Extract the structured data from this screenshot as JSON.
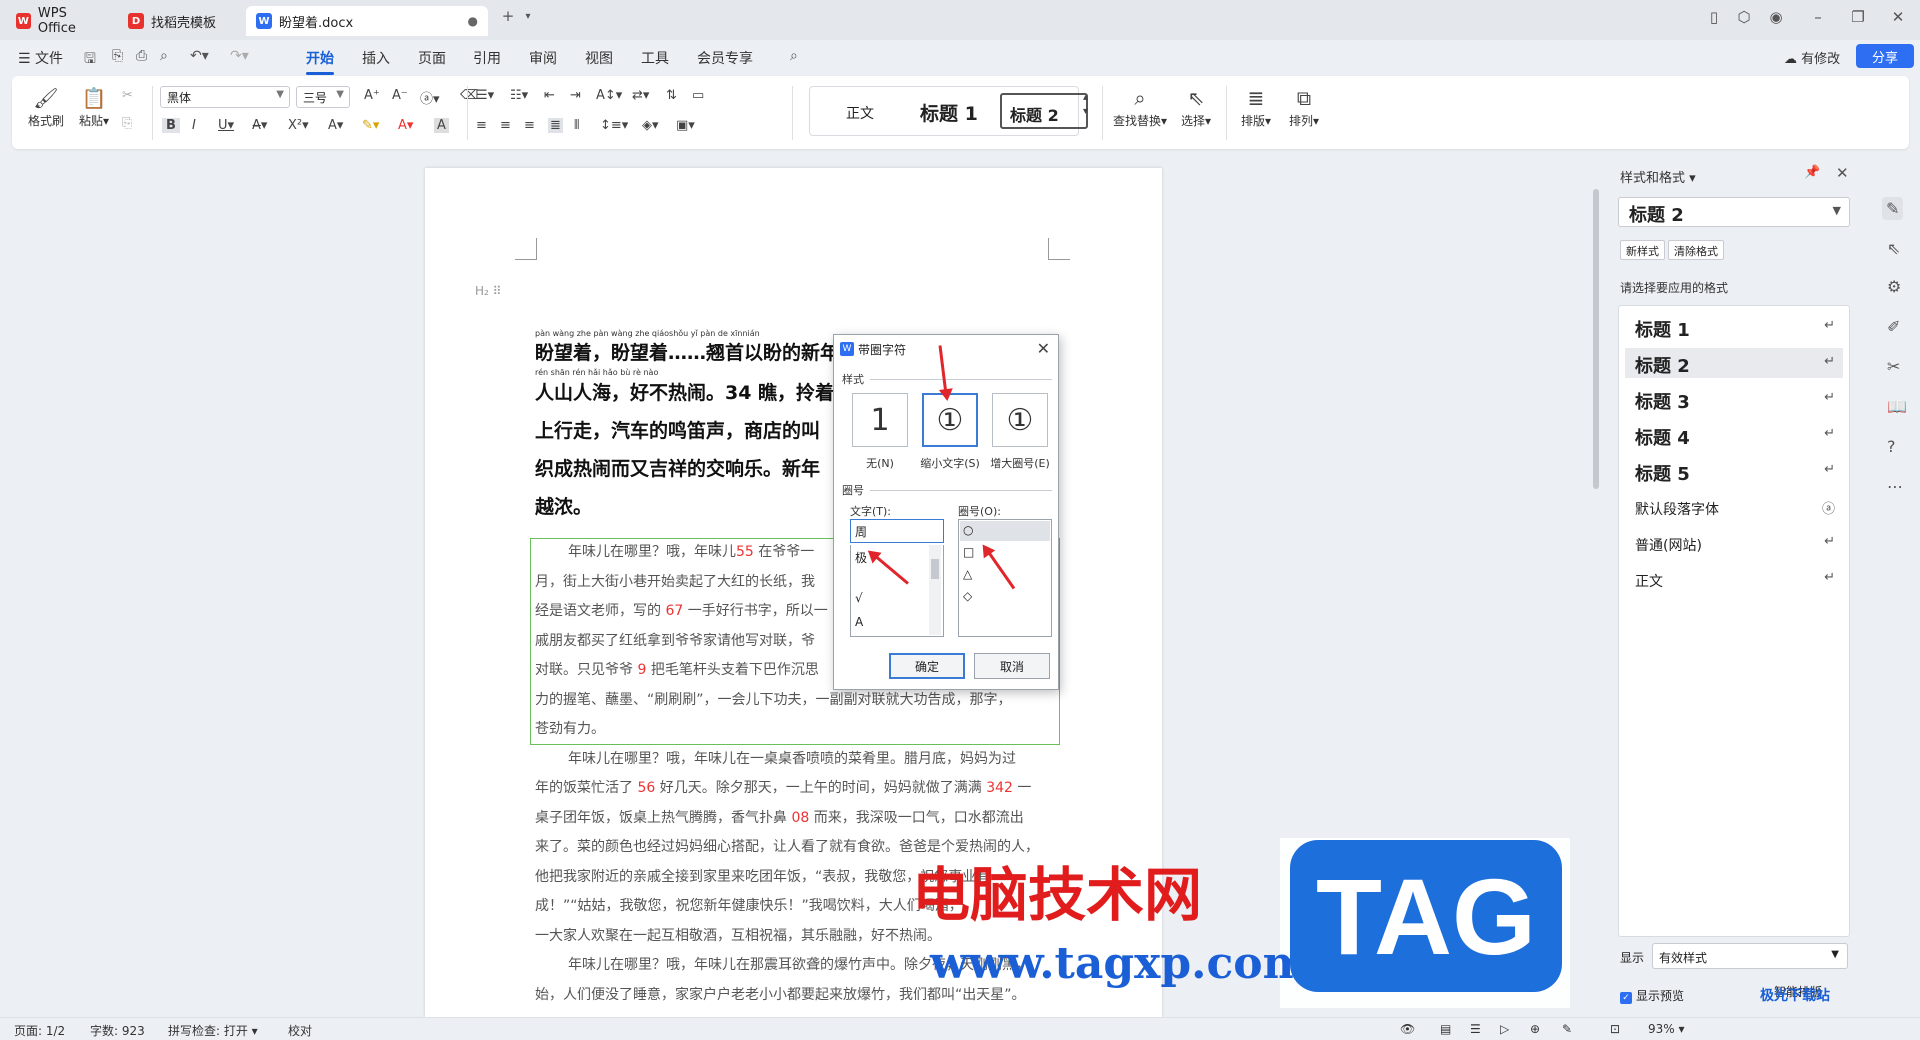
{
  "tabs": [
    {
      "label": "WPS Office",
      "icon": "wps-icon"
    },
    {
      "label": "找稻壳模板",
      "icon": "docer-icon"
    },
    {
      "label": "盼望着.docx",
      "icon": "word-doc-icon"
    }
  ],
  "menu": {
    "file": "文件",
    "items": [
      "开始",
      "插入",
      "页面",
      "引用",
      "审阅",
      "视图",
      "工具",
      "会员专享"
    ],
    "active": "开始",
    "modify": "有修改",
    "share": "分享"
  },
  "ribbon": {
    "format_painter": "格式刷",
    "paste": "粘贴",
    "font": "黑体",
    "font_size": "三号",
    "styles": [
      "正文",
      "标题 1",
      "标题 2"
    ],
    "find_replace": "查找替换",
    "select": "选择",
    "layout": "排版",
    "arrange": "排列"
  },
  "document": {
    "heading_lines": [
      "盼望着，盼望着……翘首以盼的新年",
      "人山人海，好不热闹。34 瞧，拎着",
      "上行走，汽车的鸣笛声，商店的叫",
      "织成热闹而又吉祥的交响乐。新年",
      "越浓。"
    ],
    "ruby_lines": [
      "pàn wàng zhe       pàn wàng zhe              qiáoshǒu yǐ pàn de  xīnnián",
      "rén shān rén hǎi          hǎo bù rè nào"
    ],
    "paragraphs": [
      [
        {
          "t": "年味儿在哪里？哦，年味儿"
        },
        {
          "t": "55",
          "red": true
        },
        {
          "t": " 在爷爷一"
        }
      ],
      [
        {
          "t": "月，街上大街小巷开始卖起了大红的长纸，我"
        }
      ],
      [
        {
          "t": "经是语文老师，写的 "
        },
        {
          "t": "67",
          "red": true
        },
        {
          "t": " 一手好行书字，所以一"
        }
      ],
      [
        {
          "t": "戚朋友都买了红纸拿到爷爷家请他写对联，爷"
        }
      ],
      [
        {
          "t": "对联。只见爷爷 "
        },
        {
          "t": "9",
          "red": true
        },
        {
          "t": " 把毛笔杆头支着下巴作沉思"
        }
      ],
      [
        {
          "t": "力的握笔、蘸墨、“刷刷刷”，一会儿下功夫，一副副对联就大功告成，那字，"
        }
      ],
      [
        {
          "t": "苍劲有力。"
        }
      ],
      [
        {
          "t": "年味儿在哪里？哦，年味儿在一桌桌香喷喷的菜肴里。腊月底，妈妈为过"
        }
      ],
      [
        {
          "t": "年的饭菜忙活了 "
        },
        {
          "t": "56",
          "red": true
        },
        {
          "t": " 好几天。除夕那天，一上午的时间，妈妈就做了满满 "
        },
        {
          "t": "342",
          "red": true
        },
        {
          "t": " 一"
        }
      ],
      [
        {
          "t": "桌子团年饭，饭桌上热气腾腾，香气扑鼻 "
        },
        {
          "t": "08",
          "red": true
        },
        {
          "t": " 而来，我深吸一口气，口水都流出"
        }
      ],
      [
        {
          "t": "来了。菜的颜色也经过妈妈细心搭配，让人看了就有食欲。爸爸是个爱热闹的人，"
        }
      ],
      [
        {
          "t": "他把我家附近的亲戚全接到家里来吃团年饭，“表叔，我敬您，祝您事业有"
        }
      ],
      [
        {
          "t": "成！”“姑姑，我敬您，祝您新年健康快乐！”我喝饮料，大人们喝酒，"
        }
      ],
      [
        {
          "t": "一大家人欢聚在一起互相敬酒，互相祝福，其乐融融，好不热闹。"
        }
      ],
      [
        {
          "t": "年味儿在哪里？哦，年味儿在那震耳欲聋的爆竹声中。除夕夜，天刚刚黑，"
        }
      ],
      [
        {
          "t": "始，人们便没了睡意，家家户户老老小小都要起来放爆竹，我们都叫“出天星”。"
        }
      ]
    ]
  },
  "dialog": {
    "title": "带圈字符",
    "style_label": "样式",
    "options": [
      {
        "label": "无(N)",
        "glyph": "1"
      },
      {
        "label": "缩小文字(S)",
        "glyph": "①"
      },
      {
        "label": "增大圈号(E)",
        "glyph": "①"
      }
    ],
    "circle_section": "圈号",
    "text_label": "文字(T):",
    "text_value": "周",
    "text_list": [
      "极",
      "√",
      "A"
    ],
    "ring_label": "圈号(O):",
    "ring_list": [
      "○",
      "□",
      "△",
      "◇"
    ],
    "ok": "确定",
    "cancel": "取消"
  },
  "style_panel": {
    "title": "样式和格式",
    "current": "标题 2",
    "new_style": "新样式",
    "clear_format": "清除格式",
    "hint": "请选择要应用的格式",
    "items": [
      "标题 1",
      "标题 2",
      "标题 3",
      "标题 4",
      "标题 5",
      "默认段落字体",
      "普通(网站)",
      "正文"
    ],
    "selected": "标题 2",
    "show_label": "显示",
    "show_value": "有效样式",
    "preview": "显示预览",
    "smart_layout": "智能排版"
  },
  "status": {
    "page": "页面: 1/2",
    "words": "字数: 923",
    "spell": "拼写检查: 打开",
    "proof": "校对",
    "zoom": "93%"
  },
  "watermark": {
    "title": "电脑技术网",
    "url": "www.tagxp.com",
    "tag": "TAG",
    "logo": "极光下载站"
  },
  "colors": {
    "accent": "#1a5fd6",
    "share": "#2d6ef2",
    "annotation": "#e0252b"
  }
}
